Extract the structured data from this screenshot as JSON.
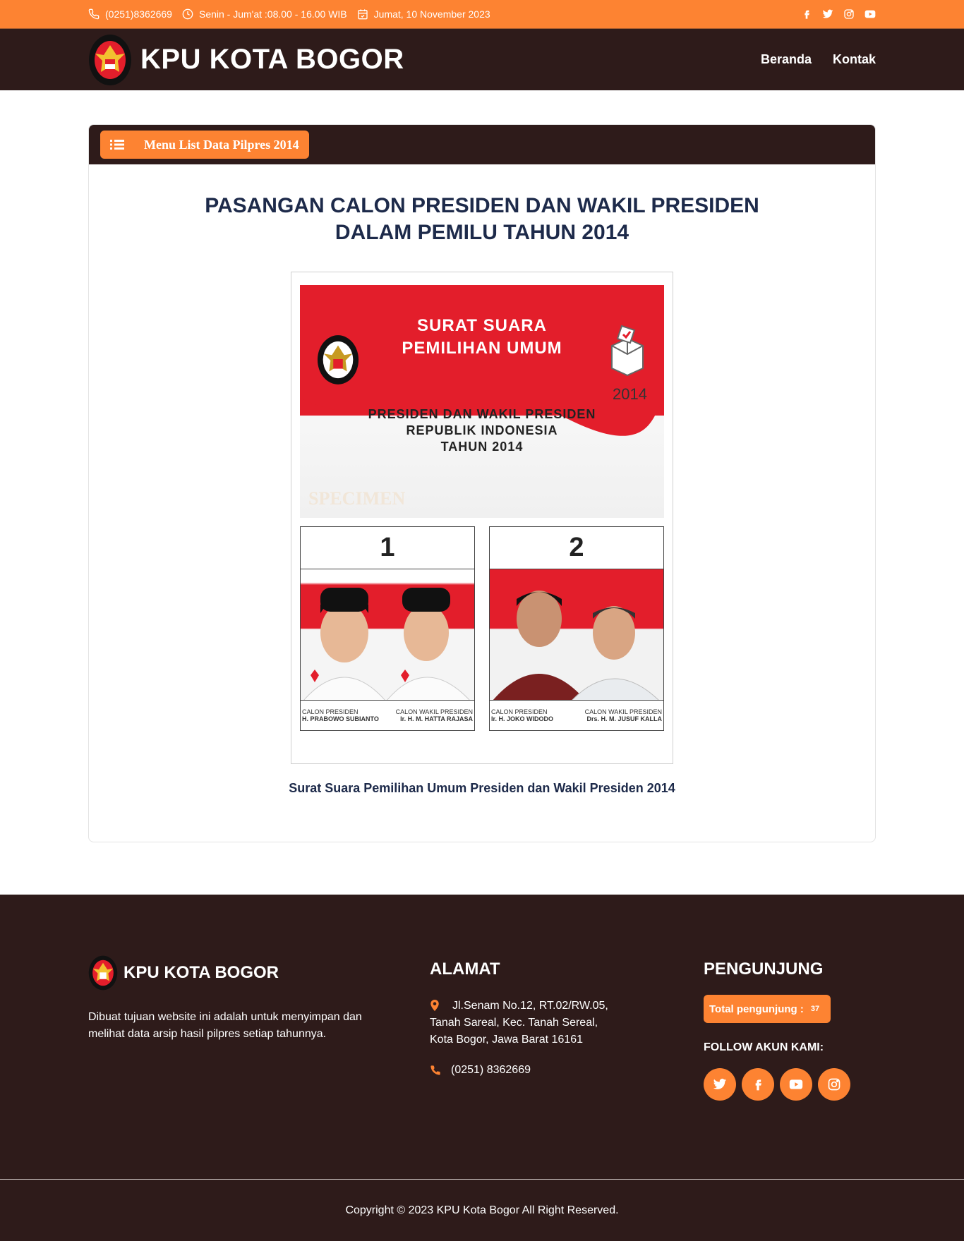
{
  "topbar": {
    "phone": "(0251)8362669",
    "hours": "Senin - Jum'at :08.00 - 16.00 WIB",
    "date": "Jumat, 10 November 2023"
  },
  "header": {
    "title": "KPU KOTA BOGOR",
    "nav": [
      "Beranda",
      "Kontak"
    ]
  },
  "card": {
    "menu_label": "Menu List Data Pilpres 2014",
    "title_line1": "PASANGAN CALON PRESIDEN DAN WAKIL PRESIDEN",
    "title_line2": "DALAM PEMILU TAHUN 2014",
    "caption": "Surat Suara Pemilihan Umum Presiden dan Wakil Presiden 2014"
  },
  "ballot": {
    "heading1": "SURAT SUARA",
    "heading2": "PEMILIHAN UMUM",
    "sub1": "PRESIDEN DAN WAKIL PRESIDEN",
    "sub2": "REPUBLIK INDONESIA",
    "sub3": "TAHUN 2014",
    "year": "2014",
    "watermark": "SPECIMEN",
    "candidates": [
      {
        "num": "1",
        "role_p": "CALON PRESIDEN",
        "role_w": "CALON WAKIL PRESIDEN",
        "name_p": "H. PRABOWO SUBIANTO",
        "name_w": "Ir. H. M. HATTA RAJASA"
      },
      {
        "num": "2",
        "role_p": "CALON PRESIDEN",
        "role_w": "CALON WAKIL PRESIDEN",
        "name_p": "Ir. H. JOKO WIDODO",
        "name_w": "Drs. H. M. JUSUF KALLA"
      }
    ]
  },
  "footer": {
    "brand": "KPU KOTA BOGOR",
    "desc": "Dibuat tujuan website ini adalah untuk menyimpan dan melihat data arsip hasil pilpres setiap tahunnya.",
    "alamat_head": "ALAMAT",
    "addr_line1": "Jl.Senam No.12, RT.02/RW.05,",
    "addr_line2": "Tanah Sareal, Kec. Tanah Sereal,",
    "addr_line3": "Kota Bogor, Jawa Barat 16161",
    "phone": "(0251) 8362669",
    "visitor_head": "PENGUNJUNG",
    "visitor_label": "Total pengunjung :",
    "visitor_count": "37",
    "follow_label": "FOLLOW AKUN KAMI:",
    "copyright": "Copyright © 2023 KPU Kota Bogor All Right Reserved."
  },
  "colors": {
    "accent": "#fd8332",
    "dark": "#2e1b1a",
    "title": "#1d2a4a"
  }
}
